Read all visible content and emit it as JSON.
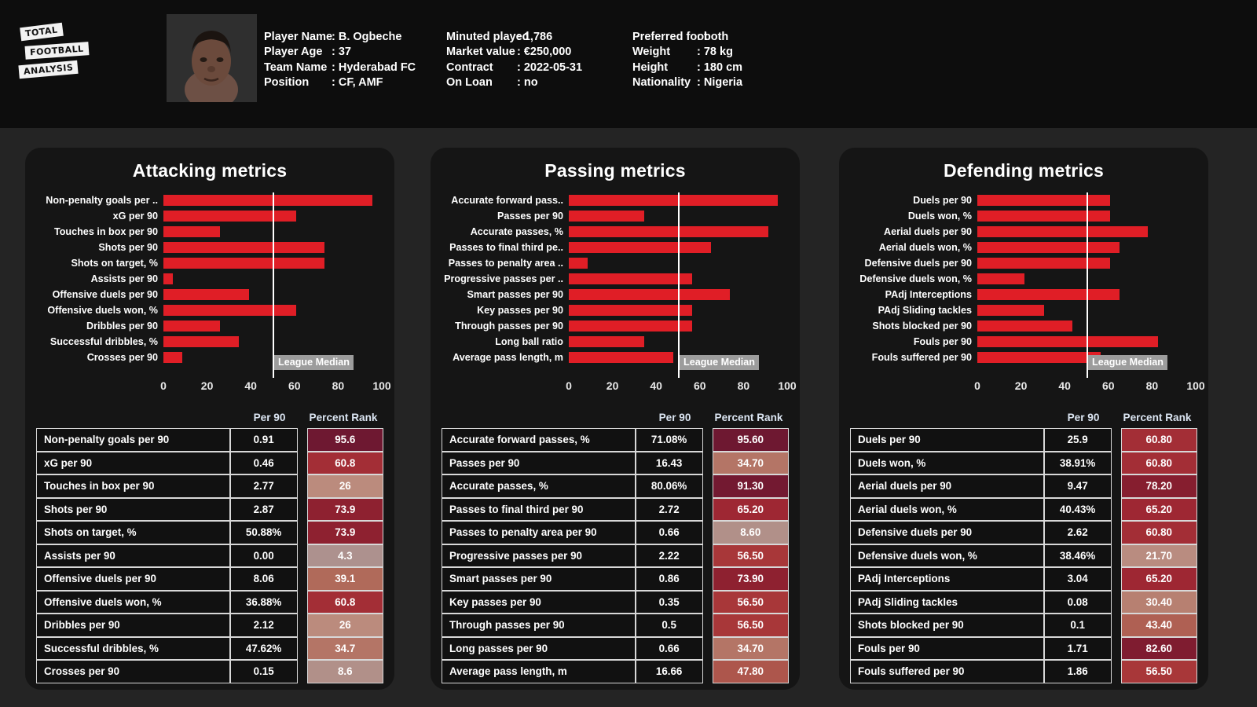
{
  "brand": {
    "line1": "TOTAL",
    "line2": "FOOTBALL",
    "line3": "ANALYSIS"
  },
  "header": {
    "col1": [
      {
        "key": "Player Name",
        "value": ": B. Ogbeche"
      },
      {
        "key": "Player Age",
        "value": ": 37"
      },
      {
        "key": "Team Name",
        "value": ": Hyderabad FC"
      },
      {
        "key": "Position",
        "value": ": CF, AMF"
      }
    ],
    "col2": [
      {
        "key": "Minuted played",
        "value": ": 1,786"
      },
      {
        "key": "Market value",
        "value": ": €250,000"
      },
      {
        "key": "Contract",
        "value": ": 2022-05-31"
      },
      {
        "key": "On Loan",
        "value": ": no"
      }
    ],
    "col3": [
      {
        "key": "Preferred foot",
        "value": ": both"
      },
      {
        "key": "Weight",
        "value": ": 78 kg"
      },
      {
        "key": "Height",
        "value": ": 180 cm"
      },
      {
        "key": "Nationality",
        "value": ": Nigeria"
      }
    ]
  },
  "median_label": "League Median",
  "axis_ticks": [
    "0",
    "20",
    "40",
    "60",
    "80",
    "100"
  ],
  "table_headers": {
    "metric": "",
    "per90": "Per 90",
    "rank": "Percent Rank"
  },
  "colors": {
    "bar": "#e01e26",
    "median": "#ffffff",
    "median_tag_bg": "#9c9c9c"
  },
  "chart_data": [
    {
      "type": "bar",
      "title": "Attacking metrics",
      "xlabel": "",
      "ylabel": "",
      "xlim": [
        0,
        100
      ],
      "grid": false,
      "median": 50,
      "orientation": "horizontal",
      "categories": [
        "Non-penalty goals per ..",
        "xG per 90",
        "Touches in box per 90",
        "Shots per 90",
        "Shots on target, %",
        "Assists per 90",
        "Offensive duels per 90",
        "Offensive duels won, %",
        "Dribbles per 90",
        "Successful dribbles, %",
        "Crosses per 90"
      ],
      "values": [
        95.6,
        60.8,
        26,
        73.9,
        73.9,
        4.3,
        39.1,
        60.8,
        26,
        34.7,
        8.6
      ],
      "table": {
        "columns": [
          "Metric",
          "Per 90",
          "Percent Rank"
        ],
        "rows": [
          {
            "metric": "Non-penalty goals per 90",
            "per90": "0.91",
            "rank": "95.6",
            "rank_value": 95.6
          },
          {
            "metric": "xG per 90",
            "per90": "0.46",
            "rank": "60.8",
            "rank_value": 60.8
          },
          {
            "metric": "Touches in box per 90",
            "per90": "2.77",
            "rank": "26",
            "rank_value": 26
          },
          {
            "metric": "Shots per 90",
            "per90": "2.87",
            "rank": "73.9",
            "rank_value": 73.9
          },
          {
            "metric": "Shots on target, %",
            "per90": "50.88%",
            "rank": "73.9",
            "rank_value": 73.9
          },
          {
            "metric": "Assists per 90",
            "per90": "0.00",
            "rank": "4.3",
            "rank_value": 4.3
          },
          {
            "metric": "Offensive duels per 90",
            "per90": "8.06",
            "rank": "39.1",
            "rank_value": 39.1
          },
          {
            "metric": "Offensive duels won, %",
            "per90": "36.88%",
            "rank": "60.8",
            "rank_value": 60.8
          },
          {
            "metric": "Dribbles per 90",
            "per90": "2.12",
            "rank": "26",
            "rank_value": 26
          },
          {
            "metric": "Successful dribbles, %",
            "per90": "47.62%",
            "rank": "34.7",
            "rank_value": 34.7
          },
          {
            "metric": "Crosses per 90",
            "per90": "0.15",
            "rank": "8.6",
            "rank_value": 8.6
          }
        ]
      }
    },
    {
      "type": "bar",
      "title": "Passing metrics",
      "xlabel": "",
      "ylabel": "",
      "xlim": [
        0,
        100
      ],
      "grid": false,
      "median": 50,
      "orientation": "horizontal",
      "categories": [
        "Accurate forward pass..",
        "Passes per 90",
        "Accurate passes, %",
        "Passes to final third pe..",
        "Passes to penalty area ..",
        "Progressive passes per ..",
        "Smart passes per 90",
        "Key passes per 90",
        "Through passes per 90",
        "Long ball ratio",
        "Average pass length, m"
      ],
      "values": [
        95.6,
        34.7,
        91.3,
        65.2,
        8.6,
        56.5,
        73.9,
        56.5,
        56.5,
        34.7,
        47.8
      ],
      "table": {
        "columns": [
          "Metric",
          "Per 90",
          "Percent Rank"
        ],
        "rows": [
          {
            "metric": "Accurate forward passes, %",
            "per90": "71.08%",
            "rank": "95.60",
            "rank_value": 95.6
          },
          {
            "metric": "Passes per 90",
            "per90": "16.43",
            "rank": "34.70",
            "rank_value": 34.7
          },
          {
            "metric": "Accurate passes, %",
            "per90": "80.06%",
            "rank": "91.30",
            "rank_value": 91.3
          },
          {
            "metric": "Passes to final third per 90",
            "per90": "2.72",
            "rank": "65.20",
            "rank_value": 65.2
          },
          {
            "metric": "Passes to penalty area per 90",
            "per90": "0.66",
            "rank": "8.60",
            "rank_value": 8.6
          },
          {
            "metric": "Progressive passes per 90",
            "per90": "2.22",
            "rank": "56.50",
            "rank_value": 56.5
          },
          {
            "metric": "Smart passes per 90",
            "per90": "0.86",
            "rank": "73.90",
            "rank_value": 73.9
          },
          {
            "metric": "Key passes per 90",
            "per90": "0.35",
            "rank": "56.50",
            "rank_value": 56.5
          },
          {
            "metric": "Through passes per 90",
            "per90": "0.5",
            "rank": "56.50",
            "rank_value": 56.5
          },
          {
            "metric": "Long passes per 90",
            "per90": "0.66",
            "rank": "34.70",
            "rank_value": 34.7
          },
          {
            "metric": "Average pass length, m",
            "per90": "16.66",
            "rank": "47.80",
            "rank_value": 47.8
          }
        ]
      }
    },
    {
      "type": "bar",
      "title": "Defending metrics",
      "xlabel": "",
      "ylabel": "",
      "xlim": [
        0,
        100
      ],
      "grid": false,
      "median": 50,
      "orientation": "horizontal",
      "categories": [
        "Duels per 90",
        "Duels won, %",
        "Aerial duels per 90",
        "Aerial duels won, %",
        "Defensive duels per 90",
        "Defensive duels won, %",
        "PAdj Interceptions",
        "PAdj Sliding tackles",
        "Shots blocked per 90",
        "Fouls per 90",
        "Fouls suffered per 90"
      ],
      "values": [
        60.8,
        60.8,
        78.2,
        65.2,
        60.8,
        21.7,
        65.2,
        30.4,
        43.4,
        82.6,
        56.5
      ],
      "table": {
        "columns": [
          "Metric",
          "Per 90",
          "Percent Rank"
        ],
        "rows": [
          {
            "metric": "Duels per 90",
            "per90": "25.9",
            "rank": "60.80",
            "rank_value": 60.8
          },
          {
            "metric": "Duels won, %",
            "per90": "38.91%",
            "rank": "60.80",
            "rank_value": 60.8
          },
          {
            "metric": "Aerial duels per 90",
            "per90": "9.47",
            "rank": "78.20",
            "rank_value": 78.2
          },
          {
            "metric": "Aerial duels won, %",
            "per90": "40.43%",
            "rank": "65.20",
            "rank_value": 65.2
          },
          {
            "metric": "Defensive duels per 90",
            "per90": "2.62",
            "rank": "60.80",
            "rank_value": 60.8
          },
          {
            "metric": "Defensive duels won, %",
            "per90": "38.46%",
            "rank": "21.70",
            "rank_value": 21.7
          },
          {
            "metric": "PAdj Interceptions",
            "per90": "3.04",
            "rank": "65.20",
            "rank_value": 65.2
          },
          {
            "metric": "PAdj Sliding tackles",
            "per90": "0.08",
            "rank": "30.40",
            "rank_value": 30.4
          },
          {
            "metric": "Shots blocked per 90",
            "per90": "0.1",
            "rank": "43.40",
            "rank_value": 43.4
          },
          {
            "metric": "Fouls per 90",
            "per90": "1.71",
            "rank": "82.60",
            "rank_value": 82.6
          },
          {
            "metric": "Fouls suffered per 90",
            "per90": "1.86",
            "rank": "56.50",
            "rank_value": 56.5
          }
        ]
      }
    }
  ]
}
